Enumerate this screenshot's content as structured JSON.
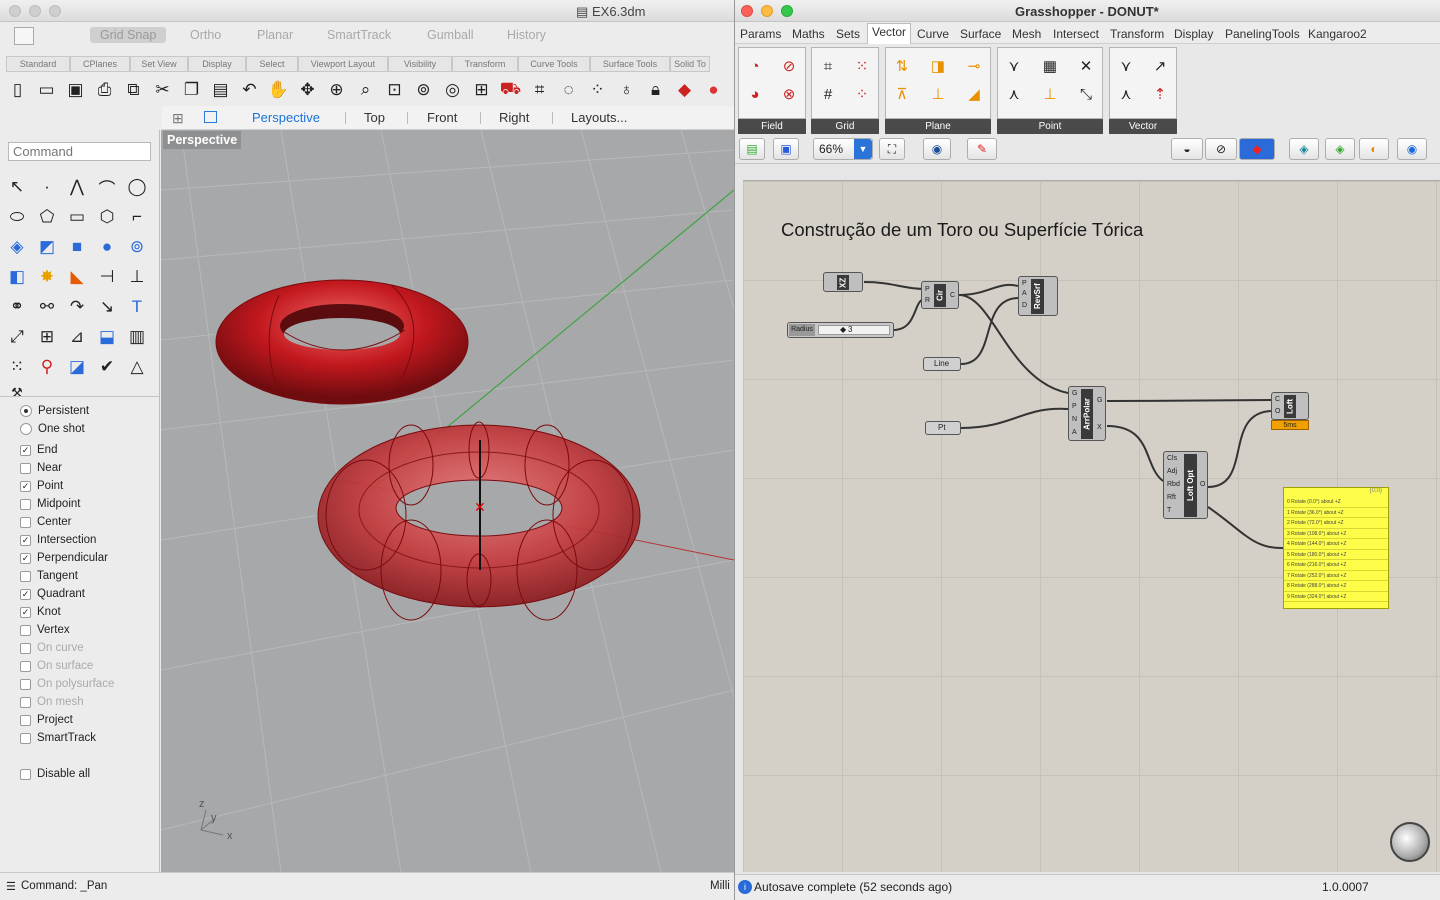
{
  "rhino": {
    "title": "EX6.3dm",
    "snap_items": [
      "Grid Snap",
      "Ortho",
      "Planar",
      "SmartTrack",
      "Gumball",
      "History"
    ],
    "toolbar_tabs": [
      "Standard",
      "CPlanes",
      "Set View",
      "Display",
      "Select",
      "Viewport Layout",
      "Visibility",
      "Transform",
      "Curve Tools",
      "Surface Tools",
      "Solid To"
    ],
    "viewport_tabs": [
      "Perspective",
      "Top",
      "Front",
      "Right",
      "Layouts..."
    ],
    "active_viewport_tab": "Perspective",
    "command_placeholder": "Command",
    "viewport_label": "Perspective",
    "osnaps": [
      {
        "label": "End",
        "checked": true,
        "enabled": true
      },
      {
        "label": "Near",
        "checked": false,
        "enabled": true
      },
      {
        "label": "Point",
        "checked": true,
        "enabled": true
      },
      {
        "label": "Midpoint",
        "checked": false,
        "enabled": true
      },
      {
        "label": "Center",
        "checked": false,
        "enabled": true
      },
      {
        "label": "Intersection",
        "checked": true,
        "enabled": true
      },
      {
        "label": "Perpendicular",
        "checked": true,
        "enabled": true
      },
      {
        "label": "Tangent",
        "checked": false,
        "enabled": true
      },
      {
        "label": "Quadrant",
        "checked": true,
        "enabled": true
      },
      {
        "label": "Knot",
        "checked": true,
        "enabled": true
      },
      {
        "label": "Vertex",
        "checked": false,
        "enabled": true
      },
      {
        "label": "On curve",
        "checked": false,
        "enabled": false
      },
      {
        "label": "On surface",
        "checked": false,
        "enabled": false
      },
      {
        "label": "On polysurface",
        "checked": false,
        "enabled": false
      },
      {
        "label": "On mesh",
        "checked": false,
        "enabled": false
      },
      {
        "label": "Project",
        "checked": false,
        "enabled": true
      },
      {
        "label": "SmartTrack",
        "checked": false,
        "enabled": true
      }
    ],
    "snap_mode": {
      "persistent": "Persistent",
      "one_shot": "One shot"
    },
    "disable_all": "Disable all",
    "command_status": "Command: _Pan",
    "units_status": "Milli",
    "axis_labels": {
      "z": "z",
      "y": "y",
      "x": "x"
    }
  },
  "grasshopper": {
    "title": "Grasshopper - DONUT*",
    "menu": [
      "Params",
      "Maths",
      "Sets",
      "Vector",
      "Curve",
      "Surface",
      "Mesh",
      "Intersect",
      "Transform",
      "Display",
      "PanelingTools",
      "Kangaroo2"
    ],
    "active_menu": "Vector",
    "ribbon_groups": [
      "Field",
      "Grid",
      "Plane",
      "Point",
      "Vector"
    ],
    "zoom": "66%",
    "canvas_title": "Construção de um Toro ou Superfície Tórica",
    "nodes": {
      "xz": "XZ",
      "cir": "Cir",
      "revsrf": "RevSrf",
      "arrpolar": "ArrPolar",
      "loft": "Loft",
      "loftopt": "Loft Opt",
      "slider_label": "Radius",
      "slider_value": "3",
      "line": "Line",
      "pt": "Pt",
      "loft_time": "5ms"
    },
    "panel_header": "{0;0}",
    "panel_rows": [
      "0 Rotate (0.0°) about +Z",
      "1 Rotate (36.0°) about +Z",
      "2 Rotate (72.0°) about +Z",
      "3 Rotate (108.0°) about +Z",
      "4 Rotate (144.0°) about +Z",
      "5 Rotate (180.0°) about +Z",
      "6 Rotate (216.0°) about +Z",
      "7 Rotate (252.0°) about +Z",
      "8 Rotate (288.0°) about +Z",
      "9 Rotate (324.0°) about +Z"
    ],
    "status": "Autosave complete (52 seconds ago)",
    "version": "1.0.0007"
  },
  "colors": {
    "torus": "#c21f24",
    "active_tab": "#1a73d9",
    "panel": "#fdfd4a"
  }
}
